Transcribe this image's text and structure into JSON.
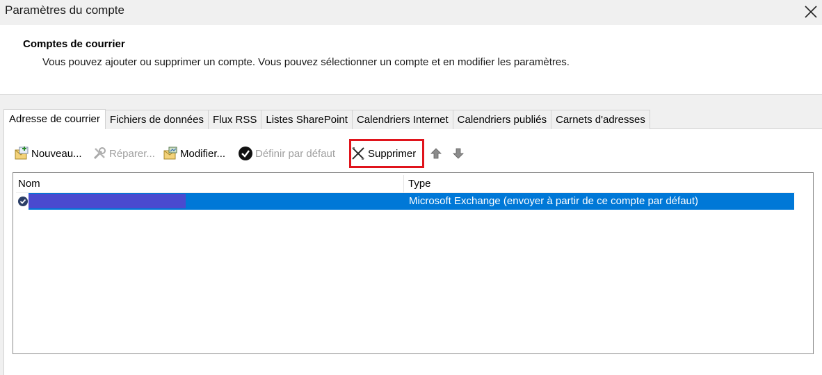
{
  "window": {
    "title": "Paramètres du compte",
    "close_icon": "close-icon"
  },
  "header": {
    "heading": "Comptes de courrier",
    "description": "Vous pouvez ajouter ou supprimer un compte. Vous pouvez sélectionner un compte et en modifier les paramètres."
  },
  "tabs": [
    {
      "label": "Adresse de courrier",
      "active": true
    },
    {
      "label": "Fichiers de données",
      "active": false
    },
    {
      "label": "Flux RSS",
      "active": false
    },
    {
      "label": "Listes SharePoint",
      "active": false
    },
    {
      "label": "Calendriers Internet",
      "active": false
    },
    {
      "label": "Calendriers publiés",
      "active": false
    },
    {
      "label": "Carnets d'adresses",
      "active": false
    }
  ],
  "toolbar": {
    "new_label": "Nouveau...",
    "repair_label": "Réparer...",
    "change_label": "Modifier...",
    "default_label": "Définir par défaut",
    "remove_label": "Supprimer",
    "move_up_icon": "arrow-up-icon",
    "move_down_icon": "arrow-down-icon",
    "highlight_color": "#e0141c"
  },
  "accounts_list": {
    "columns": [
      "Nom",
      "Type"
    ],
    "rows": [
      {
        "name": "",
        "name_redacted": true,
        "type": "Microsoft Exchange (envoyer à partir de ce compte par défaut)",
        "selected": true,
        "is_default": true
      }
    ],
    "selection_color": "#0078d7",
    "redaction_color": "#4a4acf"
  }
}
